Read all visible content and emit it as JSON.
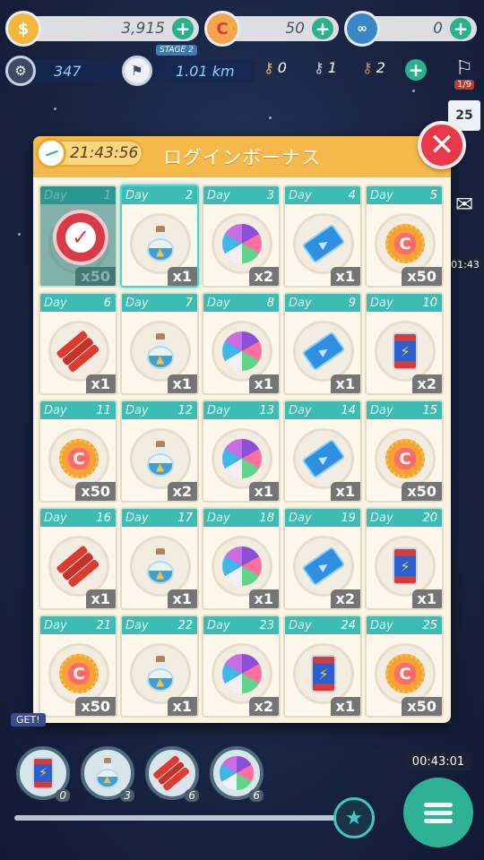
{
  "top": {
    "gold_coins": "3,915",
    "gems": "50",
    "tickets": "0",
    "score": "347",
    "stage_tag": "STAGE 2",
    "distance": "1.01 km",
    "key_gold": "0",
    "key_silver": "1",
    "key_bronze": "2",
    "event_counter": "1/9",
    "calendar_day": "25",
    "side_timer": "01:43"
  },
  "modal": {
    "title": "ログインボーナス",
    "timer": "21:43:56",
    "close_symbol": "✕",
    "day_label": "Day"
  },
  "days": [
    {
      "day": "1",
      "item": "medal",
      "qty": "x50",
      "claimed": true
    },
    {
      "day": "2",
      "item": "potion",
      "qty": "x1",
      "selected": true
    },
    {
      "day": "3",
      "item": "candy",
      "qty": "x2"
    },
    {
      "day": "4",
      "item": "ticket",
      "qty": "x1"
    },
    {
      "day": "5",
      "item": "medal",
      "qty": "x50"
    },
    {
      "day": "6",
      "item": "dynamite",
      "qty": "x1"
    },
    {
      "day": "7",
      "item": "potion",
      "qty": "x1"
    },
    {
      "day": "8",
      "item": "candy",
      "qty": "x1"
    },
    {
      "day": "9",
      "item": "ticket",
      "qty": "x1"
    },
    {
      "day": "10",
      "item": "can",
      "qty": "x2"
    },
    {
      "day": "11",
      "item": "medal",
      "qty": "x50"
    },
    {
      "day": "12",
      "item": "potion",
      "qty": "x2"
    },
    {
      "day": "13",
      "item": "candy",
      "qty": "x1"
    },
    {
      "day": "14",
      "item": "ticket",
      "qty": "x1"
    },
    {
      "day": "15",
      "item": "medal",
      "qty": "x50"
    },
    {
      "day": "16",
      "item": "dynamite",
      "qty": "x1"
    },
    {
      "day": "17",
      "item": "potion",
      "qty": "x1"
    },
    {
      "day": "18",
      "item": "candy",
      "qty": "x1"
    },
    {
      "day": "19",
      "item": "ticket",
      "qty": "x2"
    },
    {
      "day": "20",
      "item": "can",
      "qty": "x1"
    },
    {
      "day": "21",
      "item": "medal",
      "qty": "x50"
    },
    {
      "day": "22",
      "item": "potion",
      "qty": "x1"
    },
    {
      "day": "23",
      "item": "candy",
      "qty": "x2"
    },
    {
      "day": "24",
      "item": "can",
      "qty": "x1"
    },
    {
      "day": "25",
      "item": "medal",
      "qty": "x50"
    }
  ],
  "bottom": {
    "items": [
      {
        "item": "can",
        "count": "0"
      },
      {
        "item": "potion",
        "count": "3"
      },
      {
        "item": "dynamite",
        "count": "6"
      },
      {
        "item": "candy",
        "count": "6"
      }
    ],
    "timer": "00:43:01",
    "get_label": "GET!"
  },
  "colors": {
    "accent_teal": "#3cbcb4",
    "header_orange": "#f4b94a",
    "close_red": "#e8384a",
    "plus_green": "#2bb18c"
  }
}
